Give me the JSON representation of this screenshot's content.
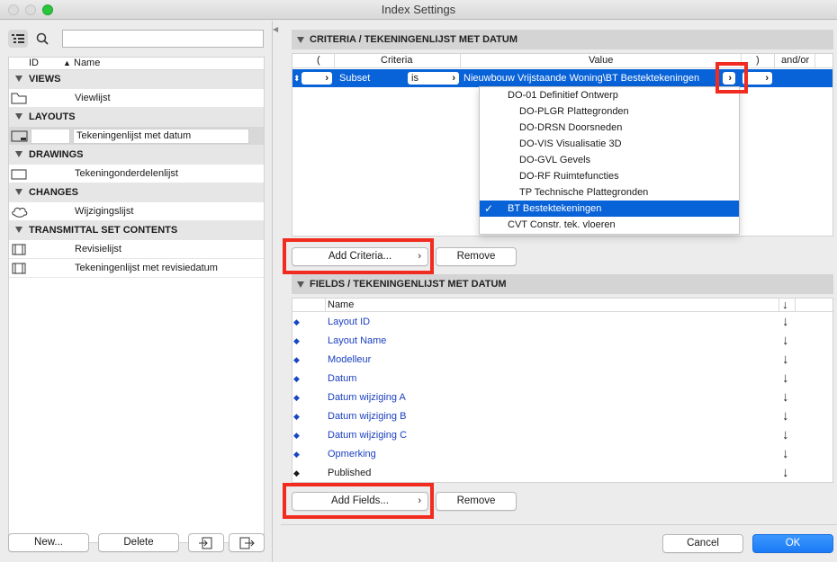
{
  "window": {
    "title": "Index Settings"
  },
  "left": {
    "columns": {
      "id": "ID",
      "name": "Name"
    },
    "groups": [
      {
        "label": "VIEWS",
        "items": [
          "Viewlijst"
        ]
      },
      {
        "label": "LAYOUTS",
        "items": [
          "Tekeningenlijst met datum"
        ]
      },
      {
        "label": "DRAWINGS",
        "items": [
          "Tekeningonderdelenlijst"
        ]
      },
      {
        "label": "CHANGES",
        "items": [
          "Wijzigingslijst"
        ]
      },
      {
        "label": "TRANSMITTAL SET CONTENTS",
        "items": [
          "Revisielijst",
          "Tekeningenlijst met revisiedatum"
        ]
      }
    ],
    "buttons": {
      "new": "New...",
      "delete": "Delete"
    }
  },
  "criteria": {
    "title": "CRITERIA /  TEKENINGENLIJST MET DATUM",
    "headers": {
      "open_paren": "(",
      "criteria": "Criteria",
      "value": "Value",
      "close_paren": ")",
      "andor": "and/or"
    },
    "row": {
      "criteria": "Subset",
      "operator": "is",
      "value": "Nieuwbouw Vrijstaande Woning\\BT Bestektekeningen"
    },
    "dropdown": {
      "items": [
        "DO-01 Definitief Ontwerp",
        "DO-PLGR Plattegronden",
        "DO-DRSN Doorsneden",
        "DO-VIS Visualisatie 3D",
        "DO-GVL Gevels",
        "DO-RF Ruimtefuncties",
        "TP Technische Plattegronden",
        "BT Bestektekeningen",
        "CVT Constr. tek. vloeren"
      ],
      "selected_index": 7,
      "check": "✓"
    },
    "add_button": "Add Criteria...",
    "remove_button": "Remove"
  },
  "fields": {
    "title": "FIELDS /  TEKENINGENLIJST MET DATUM",
    "header_name": "Name",
    "header_sort": "↓",
    "items": [
      "Layout ID",
      "Layout Name",
      "Modelleur",
      "Datum",
      "Datum wijziging A",
      "Datum wijziging B",
      "Datum wijziging C",
      "Opmerking",
      "Published"
    ],
    "sort_arrow": "↓",
    "add_button": "Add Fields...",
    "remove_button": "Remove"
  },
  "footer": {
    "cancel": "Cancel",
    "ok": "OK"
  },
  "colors": {
    "accent": "#0862d8",
    "highlight": "#f12b1f"
  }
}
